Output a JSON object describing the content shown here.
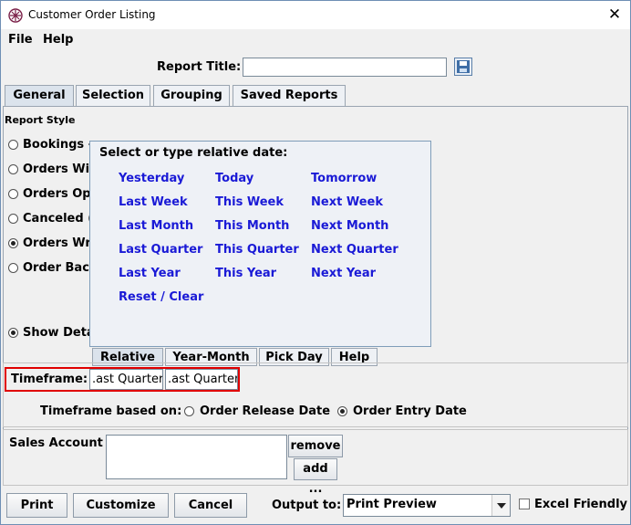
{
  "window": {
    "title": "Customer Order Listing",
    "close_glyph": "✕"
  },
  "menu": {
    "file": "File",
    "help": "Help"
  },
  "report_title": {
    "label": "Report Title:",
    "value": ""
  },
  "tabs": {
    "general": "General",
    "selection": "Selection",
    "grouping": "Grouping",
    "saved_reports": "Saved Reports"
  },
  "report_style": {
    "heading": "Report Style",
    "options": [
      "Bookings -",
      "Orders  Wi",
      "Orders Op",
      "Canceled (",
      "Orders Wri",
      "Order Back"
    ],
    "selected_index": 4,
    "show_details": "Show Deta"
  },
  "popup": {
    "heading": "Select or type relative date:",
    "links": [
      [
        "Yesterday",
        "Today",
        "Tomorrow"
      ],
      [
        "Last Week",
        "This Week",
        "Next Week"
      ],
      [
        "Last Month",
        "This Month",
        "Next Month"
      ],
      [
        "Last Quarter",
        "This Quarter",
        "Next Quarter"
      ],
      [
        "Last Year",
        "This Year",
        "Next Year"
      ]
    ],
    "reset": "Reset / Clear",
    "tabs": {
      "relative": "Relative",
      "year_month": "Year-Month",
      "pick_day": "Pick Day",
      "help": "Help"
    }
  },
  "timeframe": {
    "label": "Timeframe:",
    "from": ".ast Quarter",
    "to": ".ast Quarter",
    "based_on_label": "Timeframe based on:",
    "option_release": "Order Release Date",
    "option_entry": "Order Entry Date",
    "selected": "entry"
  },
  "sales_account": {
    "label": "Sales Account",
    "remove": "remove",
    "add": "add ..."
  },
  "footer": {
    "print": "Print",
    "customize": "Customize",
    "cancel": "Cancel",
    "output_label": "Output to:",
    "output_value": "Print Preview",
    "excel_label": "Excel Friendly",
    "excel_checked": false
  },
  "colors": {
    "link": "#1a1ad6",
    "highlight": "#e00000",
    "window_border": "#6f8fb5"
  },
  "icons": [
    "app-icon",
    "close-icon",
    "save-disk-icon",
    "dropdown-arrow-icon"
  ]
}
